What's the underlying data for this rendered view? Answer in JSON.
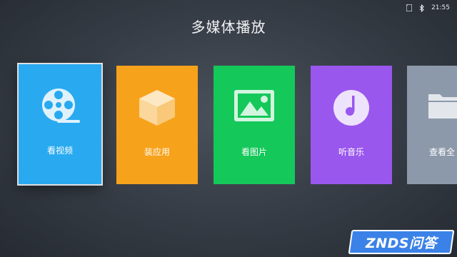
{
  "status": {
    "time": "21:55",
    "icons": [
      "sd-card-icon",
      "bluetooth-icon"
    ]
  },
  "header": {
    "title": "多媒体播放"
  },
  "tiles": [
    {
      "label": "看视频",
      "icon": "film-reel-icon",
      "color": "#29aaf0",
      "focused": true
    },
    {
      "label": "装应用",
      "icon": "box-icon",
      "color": "#f7a21b",
      "focused": false
    },
    {
      "label": "看图片",
      "icon": "image-icon",
      "color": "#14c85a",
      "focused": false
    },
    {
      "label": "听音乐",
      "icon": "music-disc-icon",
      "color": "#9a57ee",
      "focused": false
    },
    {
      "label": "查看全",
      "icon": "folder-icon",
      "color": "#8c99aa",
      "focused": false
    }
  ],
  "watermark": {
    "text": "ZNDS问答",
    "color": "#3b82e8"
  }
}
